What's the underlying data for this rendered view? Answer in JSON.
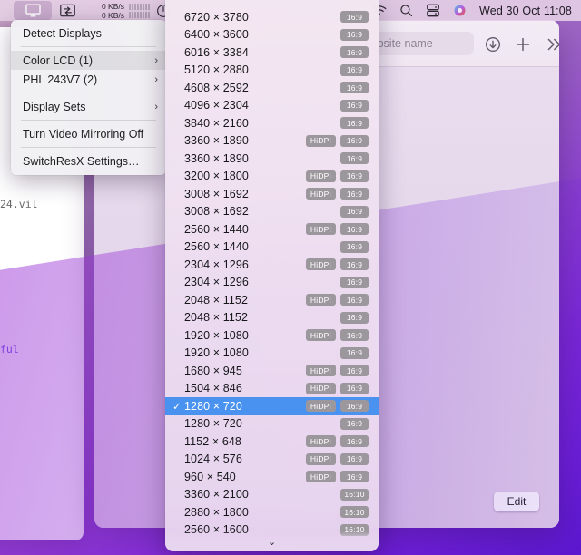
{
  "menubar": {
    "display_icon": "display-monitor-icon",
    "network_icon": "network-transfer-icon",
    "upload_rate": "0 KB/s",
    "download_rate": "0 KB/s",
    "power_icon": "power-gauge-icon",
    "wifi_icon": "wifi-icon",
    "search_icon": "spotlight-search-icon",
    "battery_icon": "battery-status-icon",
    "siri_icon": "siri-icon",
    "clock": "Wed 30 Oct  11:08"
  },
  "display_menu": {
    "items": [
      {
        "label": "Detect Displays",
        "arrow": "",
        "selected": false,
        "sep_after": true
      },
      {
        "label": "Color LCD (1)",
        "arrow": "›",
        "selected": true,
        "sep_after": false
      },
      {
        "label": "PHL 243V7 (2)",
        "arrow": "›",
        "selected": false,
        "sep_after": true
      },
      {
        "label": "Display Sets",
        "arrow": "›",
        "selected": false,
        "sep_after": true
      },
      {
        "label": "Turn Video Mirroring Off",
        "arrow": "",
        "selected": false,
        "sep_after": true
      },
      {
        "label": "SwitchResX Settings…",
        "arrow": "",
        "selected": false,
        "sep_after": false
      }
    ]
  },
  "resolution_menu": {
    "check_glyph": "✓",
    "scroll_down_glyph": "⌄",
    "rows": [
      {
        "res": "6720 × 3780",
        "hidpi": "",
        "ratio": "16:9",
        "selected": false
      },
      {
        "res": "6400 × 3600",
        "hidpi": "",
        "ratio": "16:9",
        "selected": false
      },
      {
        "res": "6016 × 3384",
        "hidpi": "",
        "ratio": "16:9",
        "selected": false
      },
      {
        "res": "5120 × 2880",
        "hidpi": "",
        "ratio": "16:9",
        "selected": false
      },
      {
        "res": "4608 × 2592",
        "hidpi": "",
        "ratio": "16:9",
        "selected": false
      },
      {
        "res": "4096 × 2304",
        "hidpi": "",
        "ratio": "16:9",
        "selected": false
      },
      {
        "res": "3840 × 2160",
        "hidpi": "",
        "ratio": "16:9",
        "selected": false
      },
      {
        "res": "3360 × 1890",
        "hidpi": "HiDPI",
        "ratio": "16:9",
        "selected": false
      },
      {
        "res": "3360 × 1890",
        "hidpi": "",
        "ratio": "16:9",
        "selected": false
      },
      {
        "res": "3200 × 1800",
        "hidpi": "HiDPI",
        "ratio": "16:9",
        "selected": false
      },
      {
        "res": "3008 × 1692",
        "hidpi": "HiDPI",
        "ratio": "16:9",
        "selected": false
      },
      {
        "res": "3008 × 1692",
        "hidpi": "",
        "ratio": "16:9",
        "selected": false
      },
      {
        "res": "2560 × 1440",
        "hidpi": "HiDPI",
        "ratio": "16:9",
        "selected": false
      },
      {
        "res": "2560 × 1440",
        "hidpi": "",
        "ratio": "16:9",
        "selected": false
      },
      {
        "res": "2304 × 1296",
        "hidpi": "HiDPI",
        "ratio": "16:9",
        "selected": false
      },
      {
        "res": "2304 × 1296",
        "hidpi": "",
        "ratio": "16:9",
        "selected": false
      },
      {
        "res": "2048 × 1152",
        "hidpi": "HiDPI",
        "ratio": "16:9",
        "selected": false
      },
      {
        "res": "2048 × 1152",
        "hidpi": "",
        "ratio": "16:9",
        "selected": false
      },
      {
        "res": "1920 × 1080",
        "hidpi": "HiDPI",
        "ratio": "16:9",
        "selected": false
      },
      {
        "res": "1920 × 1080",
        "hidpi": "",
        "ratio": "16:9",
        "selected": false
      },
      {
        "res": "1680 × 945",
        "hidpi": "HiDPI",
        "ratio": "16:9",
        "selected": false
      },
      {
        "res": "1504 × 846",
        "hidpi": "HiDPI",
        "ratio": "16:9",
        "selected": false
      },
      {
        "res": "1280 × 720",
        "hidpi": "HiDPI",
        "ratio": "16:9",
        "selected": true
      },
      {
        "res": "1280 × 720",
        "hidpi": "",
        "ratio": "16:9",
        "selected": false
      },
      {
        "res": "1152 × 648",
        "hidpi": "HiDPI",
        "ratio": "16:9",
        "selected": false
      },
      {
        "res": "1024 × 576",
        "hidpi": "HiDPI",
        "ratio": "16:9",
        "selected": false
      },
      {
        "res": "960 × 540",
        "hidpi": "HiDPI",
        "ratio": "16:9",
        "selected": false
      },
      {
        "res": "3360 × 2100",
        "hidpi": "",
        "ratio": "16:10",
        "selected": false
      },
      {
        "res": "2880 × 1800",
        "hidpi": "",
        "ratio": "16:10",
        "selected": false
      },
      {
        "res": "2560 × 1600",
        "hidpi": "",
        "ratio": "16:10",
        "selected": false
      }
    ]
  },
  "browser": {
    "search_placeholder": "Search or enter website name",
    "search_value": "",
    "download_icon": "download-icon",
    "newtab_icon": "plus-new-tab-icon",
    "more_icon": "chevron-double-right-icon",
    "edit_label": "Edit"
  },
  "editor": {
    "line1": "24.vil",
    "line2": "ful"
  }
}
